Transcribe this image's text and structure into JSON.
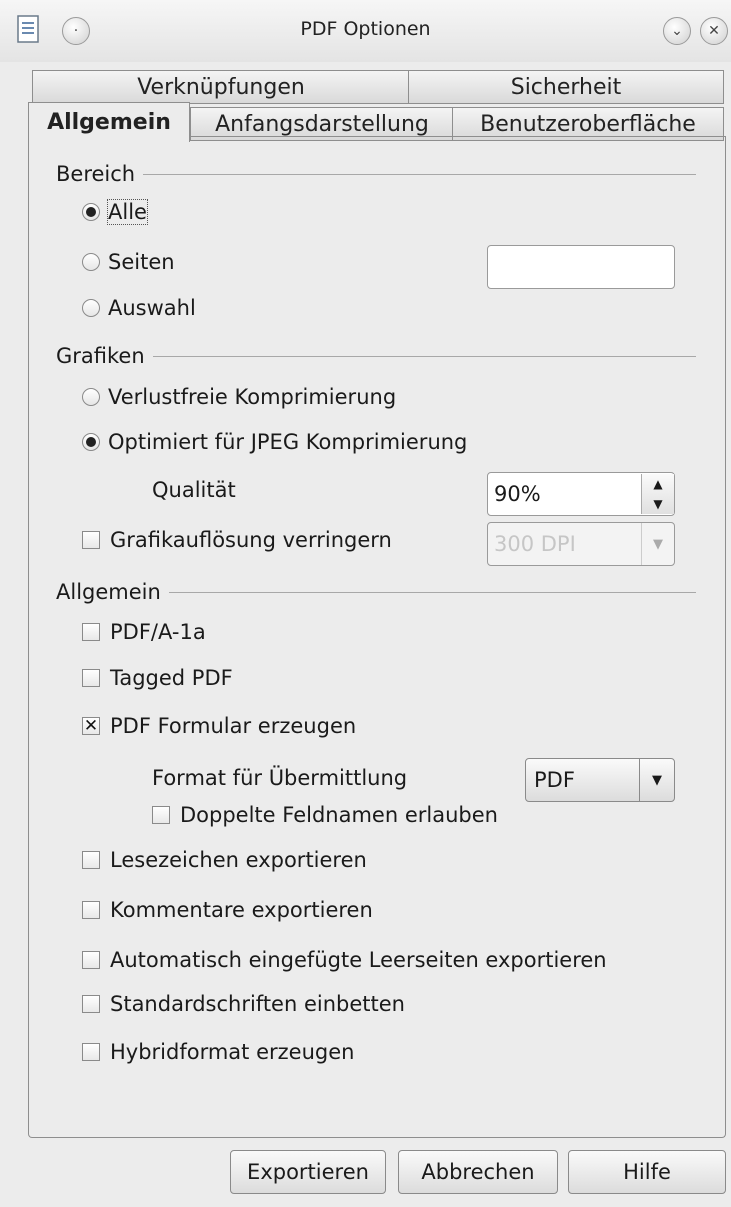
{
  "window": {
    "title": "PDF Optionen",
    "app_icon": "document-icon",
    "sticky_icon": "dot-icon",
    "minimize_icon": "chevron-down-icon",
    "close_icon": "close-icon"
  },
  "tabs": {
    "row_back": [
      "Verknüpfungen",
      "Sicherheit"
    ],
    "row_front": [
      "Allgemein",
      "Anfangsdarstellung",
      "Benutzeroberfläche"
    ],
    "active": "Allgemein"
  },
  "bereich": {
    "heading": "Bereich",
    "alle": "Alle",
    "seiten": "Seiten",
    "seiten_value": "",
    "auswahl": "Auswahl",
    "selected": "Alle"
  },
  "grafiken": {
    "heading": "Grafiken",
    "verlustfrei": "Verlustfreie Komprimierung",
    "jpeg": "Optimiert für JPEG Komprimierung",
    "selected": "Optimiert für JPEG Komprimierung",
    "qualitaet_label": "Qualität",
    "qualitaet_value": "90%",
    "aufloesung_label": "Grafikauflösung verringern",
    "aufloesung_checked": false,
    "aufloesung_value": "300 DPI"
  },
  "allgemein": {
    "heading": "Allgemein",
    "pdfa": {
      "label": "PDF/A-1a",
      "checked": false
    },
    "tagged": {
      "label": "Tagged PDF",
      "checked": false
    },
    "formular": {
      "label": "PDF Formular erzeugen",
      "checked": true
    },
    "format_label": "Format für Übermittlung",
    "format_value": "PDF",
    "doppelte": {
      "label": "Doppelte Feldnamen erlauben",
      "checked": false
    },
    "lesezeichen": {
      "label": "Lesezeichen exportieren",
      "checked": false
    },
    "kommentare": {
      "label": "Kommentare exportieren",
      "checked": false
    },
    "leerseiten": {
      "label": "Automatisch eingefügte Leerseiten exportieren",
      "checked": false
    },
    "standardschriften": {
      "label": "Standardschriften einbetten",
      "checked": false
    },
    "hybrid": {
      "label": "Hybridformat erzeugen",
      "checked": false
    }
  },
  "buttons": {
    "export": "Exportieren",
    "cancel": "Abbrechen",
    "help": "Hilfe"
  }
}
